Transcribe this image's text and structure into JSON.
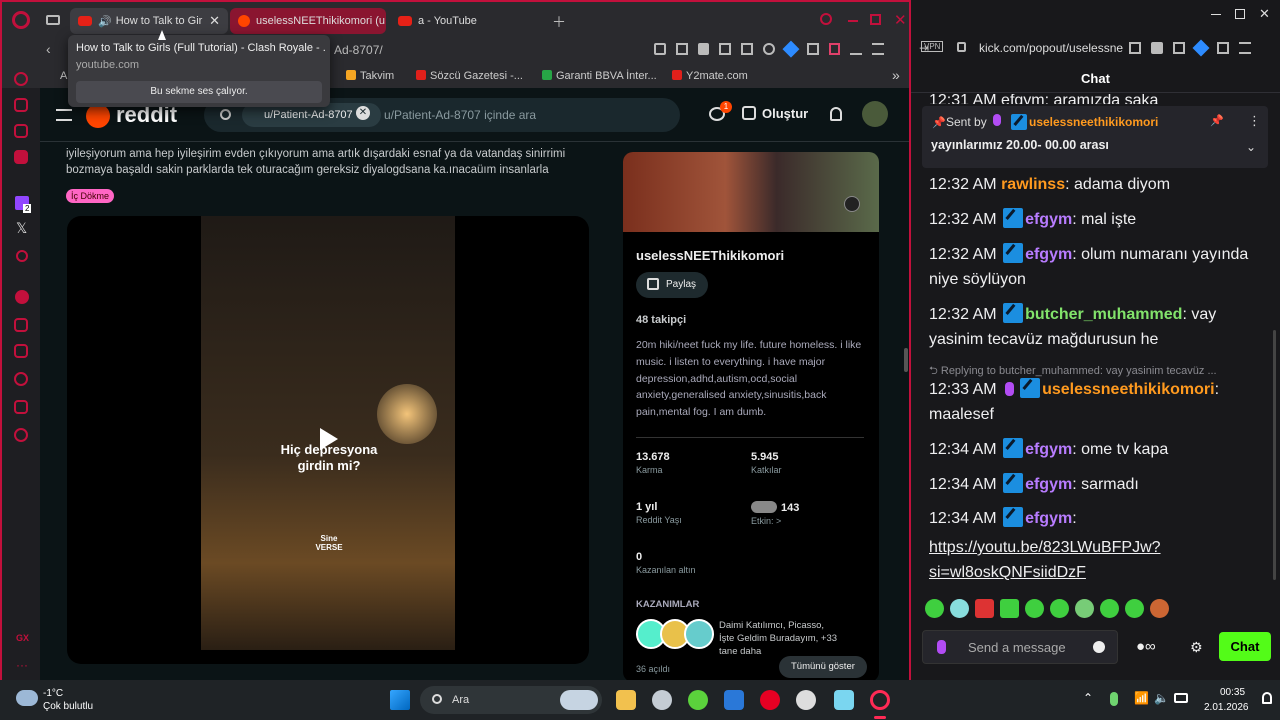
{
  "browser": {
    "tabs": [
      {
        "label": "How to Talk to Girls",
        "active": true
      },
      {
        "label": "uselessNEEThikikomori (u",
        "active": false
      },
      {
        "label": "a - YouTube",
        "active": false
      }
    ],
    "tooltip": {
      "title": "How to Talk to Girls (Full Tutorial) - Clash Royale - ...",
      "domain": "youtube.com",
      "note": "Bu sekme ses çalıyor."
    },
    "address_tail": "Ad-8707/",
    "bookmarks": [
      "A",
      "Takvim",
      "Sözcü Gazetesi -...",
      "Garanti BBVA İnter...",
      "Y2mate.com"
    ],
    "badge_count": "2"
  },
  "reddit": {
    "logo": "reddit",
    "search_chip": "u/Patient-Ad-8707",
    "search_placeholder": "u/Patient-Ad-8707 içinde ara",
    "create_label": "Oluştur",
    "chat_badge": "1",
    "post_text": "iyileşiyorum ama hep iyileşirim evden çıkıyorum ama artık dışardaki esnaf ya da vatandaş sinirrimi bozmaya başaldı sakin parklarda tek oturacağım gereksiz diyalogdsana ka.ınacaüım insanlarla",
    "flair": "İç Dökme",
    "video_caption": "Hiç depresyona girdin mi?",
    "video_watermark": "Sine VERSE",
    "profile": {
      "username": "uselessNEEThikikomori",
      "share_label": "Paylaş",
      "followers": "48 takipçi",
      "bio": "20m hiki/neet fuck my life. future homeless. i like music. i listen to everything. i have major depression,adhd,autism,ocd,social anxiety,generalised anxiety,sinusitis,back pain,mental fog. I am dumb.",
      "stats": [
        {
          "value": "13.678",
          "label": "Karma"
        },
        {
          "value": "5.945",
          "label": "Katkılar"
        },
        {
          "value": "1 yıl",
          "label": "Reddit Yaşı"
        },
        {
          "value": "143",
          "label": "Etkin: >"
        },
        {
          "value": "0",
          "label": "Kazanılan altın"
        }
      ],
      "achievements_title": "KAZANIMLAR",
      "achievements_text": "Daimi Katılımcı, Picasso, İşte Geldim Buradayım, +33 tane daha",
      "unlocked": "36 açıldı",
      "show_all": "Tümünü göster"
    }
  },
  "kick": {
    "address": "kick.com/popout/uselessne",
    "vpn": "VPN",
    "chat_title": "Chat",
    "partial_line": "12:31 AM efgym: aramızda şaka",
    "pinned": {
      "sent_by": "Sent by",
      "user": "uselessneethikikomori",
      "text": "yayınlarımız 20.00- 00.00 arası"
    },
    "messages": [
      {
        "time": "12:32 AM",
        "user": "rawlinss",
        "color": "#ff9a1f",
        "text": "adama diyom",
        "badge": false
      },
      {
        "time": "12:32 AM",
        "user": "efgym",
        "color": "#b87cff",
        "text": "mal işte",
        "badge": true
      },
      {
        "time": "12:32 AM",
        "user": "efgym",
        "color": "#b87cff",
        "text": "olum numaranı yayında niye söylüyon",
        "badge": true
      },
      {
        "time": "12:32 AM",
        "user": "butcher_muhammed",
        "color": "#82e36b",
        "text": "vay yasinim tecavüz mağdurusun he",
        "badge": true
      },
      {
        "time": "12:33 AM",
        "user": "uselessneethikikomori",
        "color": "#ff9a1f",
        "text": "maalesef",
        "badge": true
      },
      {
        "time": "12:34 AM",
        "user": "efgym",
        "color": "#b87cff",
        "text": "ome tv kapa",
        "badge": true
      },
      {
        "time": "12:34 AM",
        "user": "efgym",
        "color": "#b87cff",
        "text": "sarmadı",
        "badge": true
      },
      {
        "time": "12:34 AM",
        "user": "efgym",
        "color": "#b87cff",
        "text": "",
        "badge": true
      }
    ],
    "reply_note": "Replying to butcher_muhammed: vay yasinim tecavüz ...",
    "link1": "https://youtu.be/823LWuBFPJw?",
    "link2": "si=wl8oskQNFsiidDzF",
    "send_placeholder": "Send a message",
    "chat_button": "Chat",
    "accent": "#53fc18"
  },
  "taskbar": {
    "weather_temp": "-1°C",
    "weather_desc": "Çok bulutlu",
    "search": "Ara",
    "time": "00:35",
    "date": "2.01.2026"
  }
}
